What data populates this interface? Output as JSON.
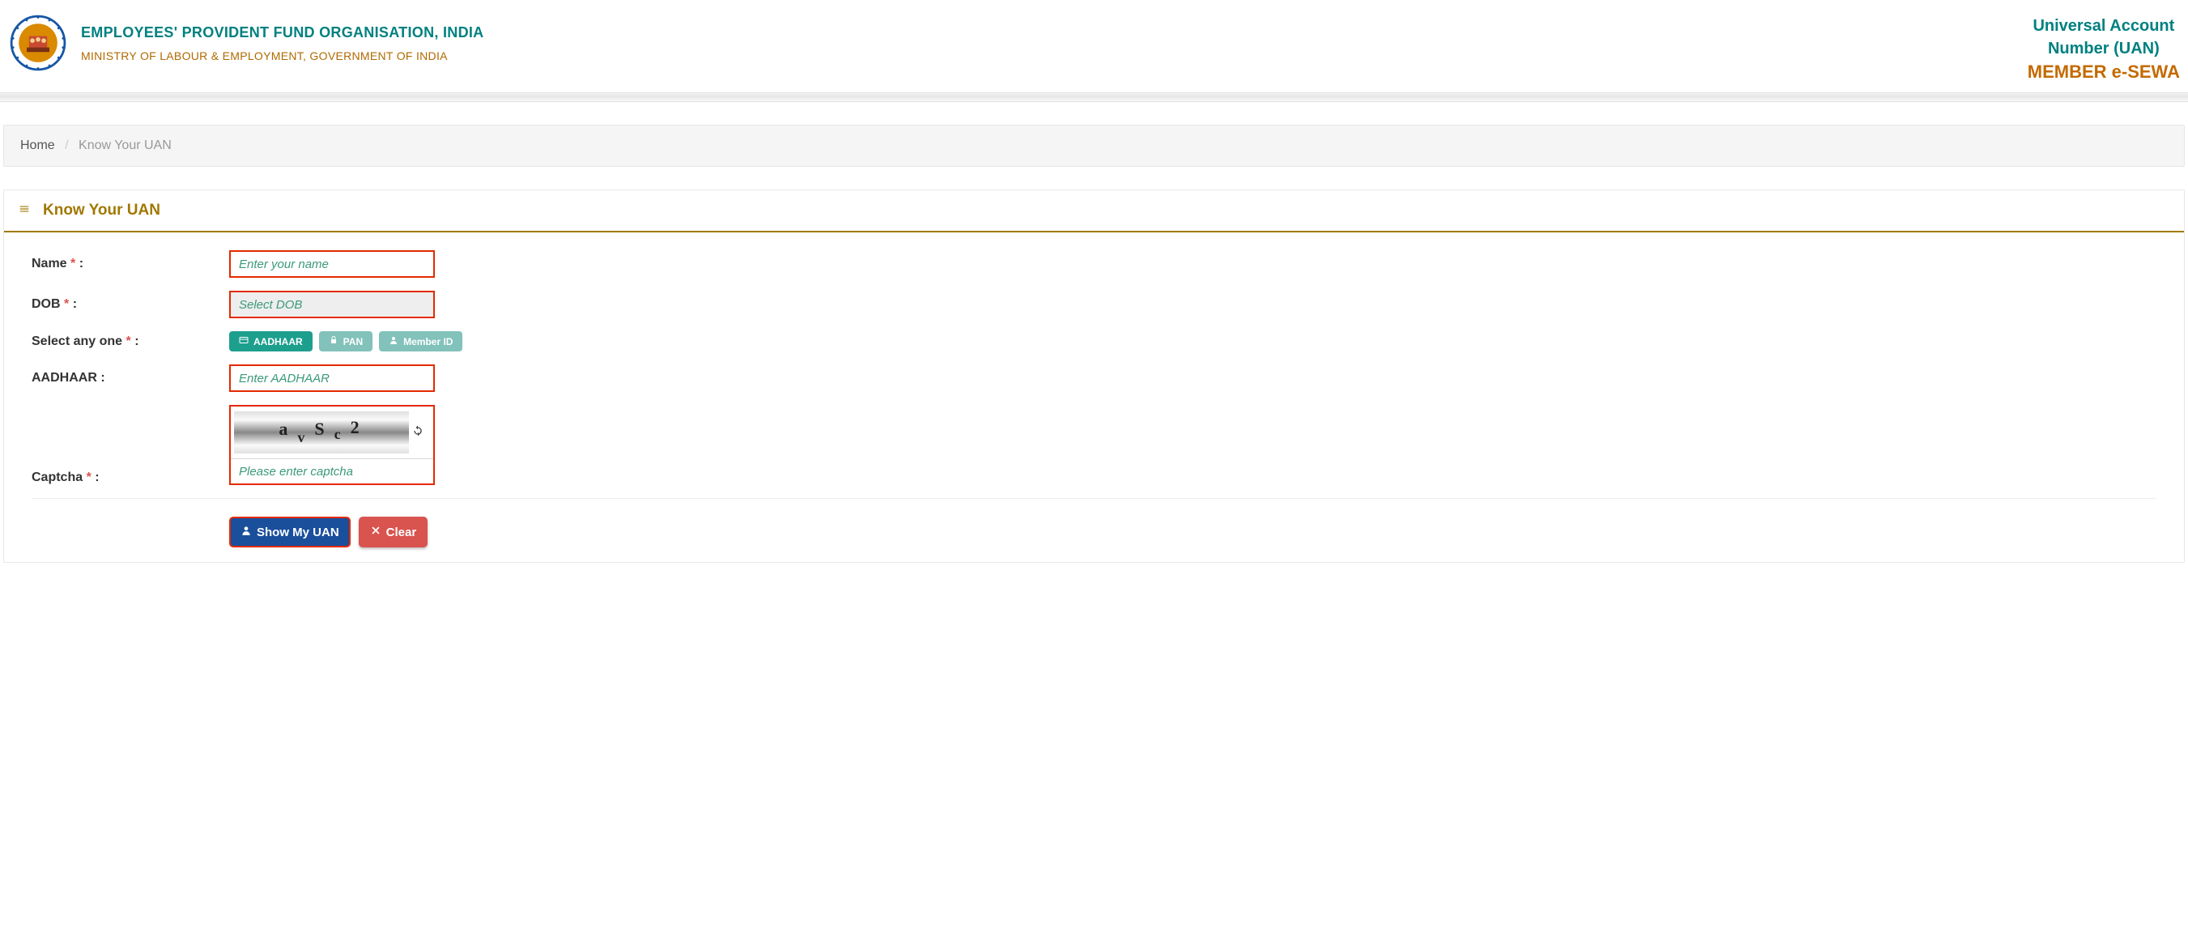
{
  "header": {
    "org_title": "EMPLOYEES' PROVIDENT FUND ORGANISATION, INDIA",
    "org_sub": "MINISTRY OF LABOUR & EMPLOYMENT, GOVERNMENT OF INDIA",
    "uan_line1": "Universal Account",
    "uan_line2": "Number (UAN)",
    "esewa": "MEMBER e-SEWA"
  },
  "breadcrumb": {
    "home": "Home",
    "sep": "/",
    "current": "Know Your UAN"
  },
  "panel": {
    "title": "Know Your UAN"
  },
  "form": {
    "name": {
      "label": "Name",
      "placeholder": "Enter your name"
    },
    "dob": {
      "label": "DOB",
      "placeholder": "Select DOB"
    },
    "select_any": {
      "label": "Select any one"
    },
    "tabs": {
      "aadhaar": "AADHAAR",
      "pan": "PAN",
      "member_id": "Member ID"
    },
    "aadhaar_field": {
      "label": "AADHAAR :",
      "placeholder": "Enter AADHAAR"
    },
    "captcha": {
      "label": "Captcha",
      "placeholder": "Please enter captcha",
      "text": "a v Sc2"
    },
    "actions": {
      "show": "Show My UAN",
      "clear": "Clear"
    },
    "colon": " :",
    "star": "*"
  }
}
